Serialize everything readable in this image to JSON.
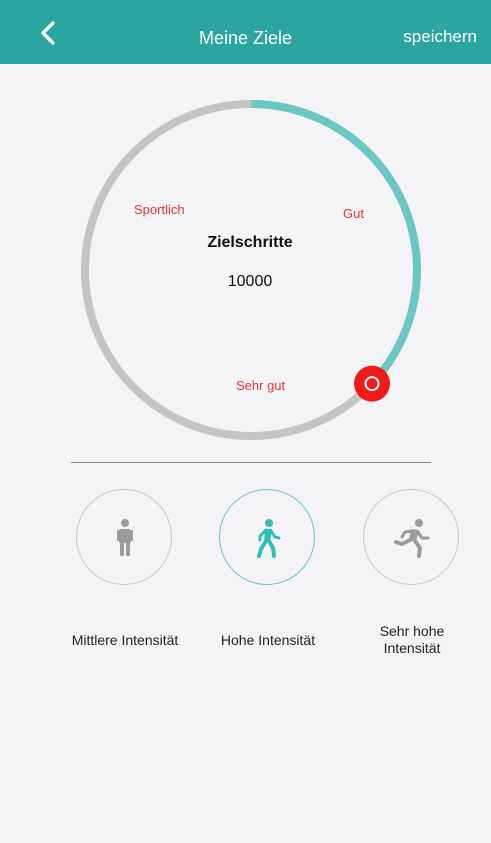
{
  "header": {
    "title": "Meine Ziele",
    "save_label": "speichern",
    "back_icon": "chevron-left-icon"
  },
  "dial": {
    "title": "Zielschritte",
    "value": "10000",
    "labels": {
      "sportlich": "Sportlich",
      "gut": "Gut",
      "sehr_gut": "Sehr gut"
    },
    "progress_fraction": 0.37,
    "colors": {
      "track": "#c4c4c4",
      "progress": "#6bc7c3",
      "handle": "#f21a1a",
      "label": "#e8333a"
    }
  },
  "intensity": {
    "options": [
      {
        "label": "Mittlere Intensität",
        "icon": "standing-person-icon",
        "selected": false
      },
      {
        "label": "Hohe Intensität",
        "icon": "walking-person-icon",
        "selected": true
      },
      {
        "label_line1": "Sehr hohe",
        "label_line2": "Intensität",
        "icon": "running-person-icon",
        "selected": false
      }
    ]
  },
  "colors": {
    "accent": "#2aa5a0",
    "selected_icon": "#2fbfb8",
    "inactive_icon": "#9b9b9b"
  }
}
